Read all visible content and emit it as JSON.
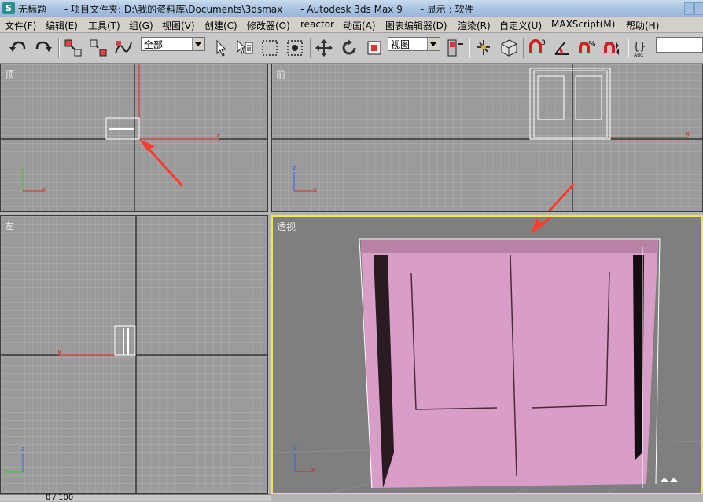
{
  "window": {
    "title": "无标题      - 项目文件夹: D:\\我的资料库\\Documents\\3dsmax      - Autodesk 3ds Max 9      - 显示 : 软件",
    "app_icon": "3ds-max-logo-icon"
  },
  "menu": [
    "文件(F)",
    "编辑(E)",
    "工具(T)",
    "组(G)",
    "视图(V)",
    "创建(C)",
    "修改器(O)",
    "reactor",
    "动画(A)",
    "图表编辑器(D)",
    "渲染(R)",
    "自定义(U)",
    "MAXScript(M)",
    "帮助(H)"
  ],
  "toolbar": {
    "selection_filter": "全部",
    "reference_coord": "视图",
    "icons": [
      "undo-icon",
      "redo-icon",
      "select-link-icon",
      "unlink-icon",
      "bind-space-warp-icon",
      "select-object-icon",
      "select-by-name-icon",
      "rectangular-region-icon",
      "window-crossing-icon",
      "move-icon",
      "rotate-icon",
      "scale-icon",
      "pivot-center-icon",
      "select-manipulate-icon",
      "keyboard-shortcut-icon",
      "snap-3d-icon",
      "angle-snap-icon",
      "percent-snap-icon",
      "spinner-snap-icon",
      "edit-named-selection-icon"
    ]
  },
  "viewports": {
    "top": {
      "label": "顶"
    },
    "front": {
      "label": "前"
    },
    "left": {
      "label": "左"
    },
    "perspective": {
      "label": "透视"
    }
  },
  "axes": {
    "x": "x",
    "y": "y",
    "z": "z"
  },
  "colors": {
    "door_pink": "#d99ec8",
    "door_edge": "#2a1a22",
    "annotation_arrow": "#ff3b2e",
    "active_border": "#f0e84a"
  },
  "timeline": {
    "frame": "0 / 100"
  }
}
